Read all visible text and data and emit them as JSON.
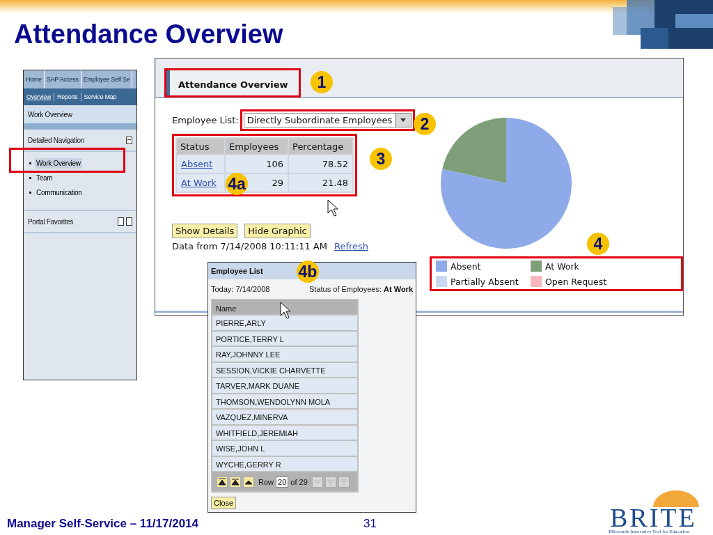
{
  "slide": {
    "title": "Attendance Overview"
  },
  "portal_nav": {
    "top_tabs": [
      {
        "label": "Home"
      },
      {
        "label": "SAP Access"
      },
      {
        "label": "Employee Self Se"
      }
    ],
    "sub_links": [
      {
        "label": "Overview",
        "selected": true
      },
      {
        "label": "Reports",
        "selected": false
      },
      {
        "label": "Service Map",
        "selected": false
      }
    ],
    "page_title": "Work Overview",
    "detailed_navigation": {
      "title": "Detailed Navigation",
      "items": [
        {
          "label": "Work Overview",
          "selected": true
        },
        {
          "label": "Team",
          "selected": false
        },
        {
          "label": "Communication",
          "selected": false
        }
      ]
    },
    "portal_favorites": {
      "title": "Portal Favorites"
    }
  },
  "attendance": {
    "tab_title": "Attendance Overview",
    "employee_list_label": "Employee List:",
    "employee_list_value": "Directly Subordinate Employees",
    "table": {
      "columns": [
        "Status",
        "Employees",
        "Percentage"
      ],
      "rows": [
        [
          "Absent",
          "106",
          "78.52"
        ],
        [
          "At Work",
          "29",
          "21.48"
        ]
      ]
    },
    "buttons": [
      "Show Details",
      "Hide Graphic"
    ],
    "data_from": "Data from 7/14/2008 10:11:11 AM",
    "refresh": "Refresh",
    "chart_data": {
      "type": "pie",
      "categories": [
        "Absent",
        "At Work",
        "Partially Absent",
        "Open Request"
      ],
      "values": [
        78.52,
        21.48,
        0,
        0
      ],
      "legend": true,
      "colors": [
        "#8eaae8",
        "#7e9f7a",
        "#cbd8f3",
        "#f6b8bc"
      ]
    }
  },
  "employee_popup": {
    "title": "Employee List",
    "today": "Today: 7/14/2008",
    "status": "Status of Employees: **At Work**",
    "column": "Name",
    "rows": [
      "PIERRE,ARLY",
      "PORTICE,TERRY L",
      "RAY,JOHNNY LEE",
      "SESSION,VICKIE CHARVETTE",
      "TARVER,MARK DUANE",
      "THOMSON,WENDOLYNN MOLA",
      "VAZQUEZ,MINERVA",
      "WHITFIELD,JEREMIAH",
      "WISE,JOHN L",
      "WYCHE,GERRY R"
    ],
    "pager": {
      "nav_buttons": [
        {
          "kind": "first",
          "disabled": false
        },
        {
          "kind": "page-up",
          "disabled": false
        },
        {
          "kind": "up",
          "disabled": false
        }
      ],
      "row_label": "Row",
      "row_value": "20",
      "of_label": "of 29",
      "nav_buttons_after": [
        {
          "kind": "down",
          "disabled": true
        },
        {
          "kind": "page-down",
          "disabled": true
        },
        {
          "kind": "last",
          "disabled": true
        }
      ]
    },
    "close": "Close"
  },
  "callouts": [
    {
      "label": "1"
    },
    {
      "label": "2"
    },
    {
      "label": "3"
    },
    {
      "label": "4a"
    },
    {
      "label": "4"
    },
    {
      "label": "4b"
    }
  ],
  "footer": {
    "text": "Manager Self-Service – 11/17/2014",
    "page_number": "31",
    "logo": "BRITE",
    "logo_tagline": "BRowards Innovative Tool for Education"
  }
}
